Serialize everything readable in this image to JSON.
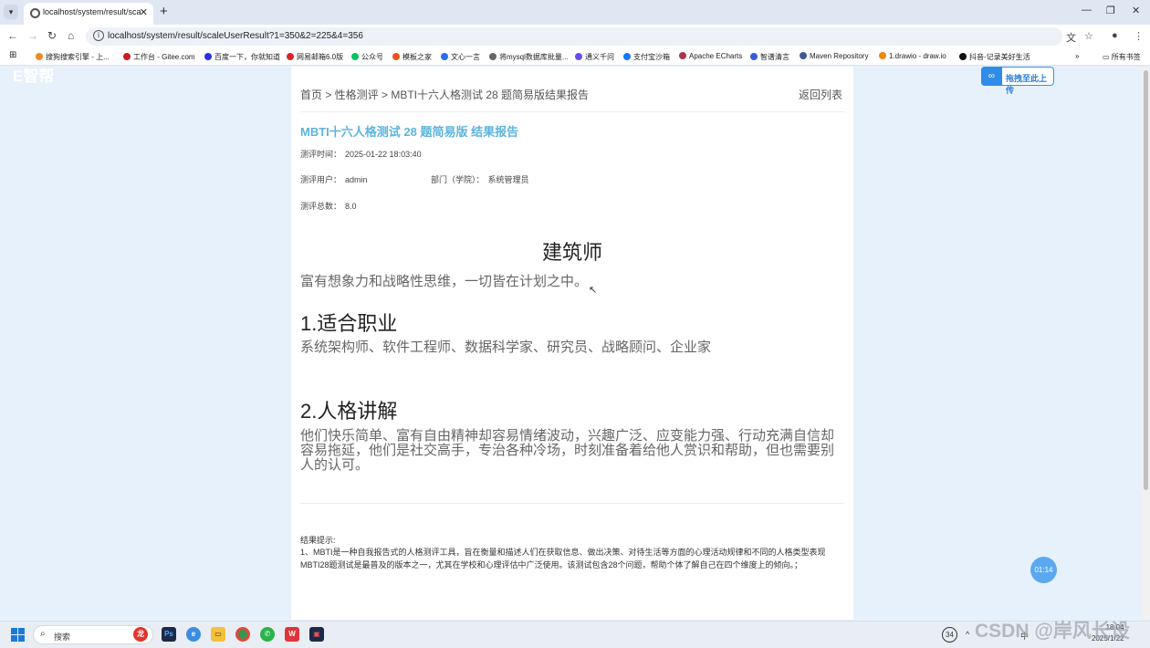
{
  "browser": {
    "tab_title": "localhost/system/result/scale",
    "url": "localhost/system/result/scaleUserResult?1=350&2=225&4=356",
    "bookmarks": [
      {
        "label": "搜狗搜索引擎 - 上...",
        "color": "#f08a24"
      },
      {
        "label": "工作台 - Gitee.com",
        "color": "#c71d23"
      },
      {
        "label": "百度一下，你就知道",
        "color": "#2932e1"
      },
      {
        "label": "网易邮箱6.0版",
        "color": "#d9232d"
      },
      {
        "label": "公众号",
        "color": "#07c160"
      },
      {
        "label": "模板之家",
        "color": "#e8541e"
      },
      {
        "label": "文心一言",
        "color": "#2a6ee8"
      },
      {
        "label": "将mysql数据库批量...",
        "color": "#666666"
      },
      {
        "label": "通义千问",
        "color": "#6b4ce6"
      },
      {
        "label": "支付宝沙箱",
        "color": "#1677ff"
      },
      {
        "label": "Apache ECharts",
        "color": "#aa344d"
      },
      {
        "label": "智谱清言",
        "color": "#3b5bdb"
      },
      {
        "label": "Maven Repository",
        "color": "#3d5a99"
      },
      {
        "label": "1.drawio - draw.io",
        "color": "#f08705"
      },
      {
        "label": "抖音-记录美好生活",
        "color": "#111111"
      }
    ],
    "all_bookmarks": "所有书签"
  },
  "page": {
    "faded_logo": "E智帮",
    "upload_label": "拖拽至此上传",
    "timer": "01:14",
    "breadcrumb": "首页 > 性格测评 > MBTI十六人格测试 28 题简易版结果报告",
    "back_link": "返回列表",
    "report_title": "MBTI十六人格测试 28 题简易版 结果报告",
    "meta": {
      "time_label": "测评时间：",
      "time_value": "2025-01-22 18:03:40",
      "user_label": "测评用户：",
      "user_value": "admin",
      "dept_label": "部门（学院）：",
      "dept_value": "系统管理员",
      "score_label": "测评总数：",
      "score_value": "8.0"
    },
    "type_name": "建筑师",
    "type_desc": "富有想象力和战略性思维，一切皆在计划之中。",
    "section1_title": "1.适合职业",
    "section1_text": "系统架构师、软件工程师、数据科学家、研究员、战略顾问、企业家",
    "section2_title": "2.人格讲解",
    "section2_text": "他们快乐简单、富有自由精神却容易情绪波动，兴趣广泛、应变能力强、行动充满自信却容易拖延，他们是社交高手，专治各种冷场，时刻准备着给他人赏识和帮助，但也需要别人的认可。",
    "tip_label": "结果提示:",
    "tip_text": "1、MBTI是一种自我报告式的人格测评工具，旨在衡量和描述人们在获取信息、做出决策、对待生活等方面的心理活动规律和不同的人格类型表现MBTI28题测试是最普及的版本之一，尤其在学校和心理评估中广泛使用。该测试包含28个问题，帮助个体了解自己在四个维度上的倾向。；"
  },
  "taskbar": {
    "search_text": "搜索",
    "badge": "34",
    "lang": "中",
    "time": "18:04",
    "date": "2025/1/22",
    "watermark": "CSDN @岸风长设"
  }
}
